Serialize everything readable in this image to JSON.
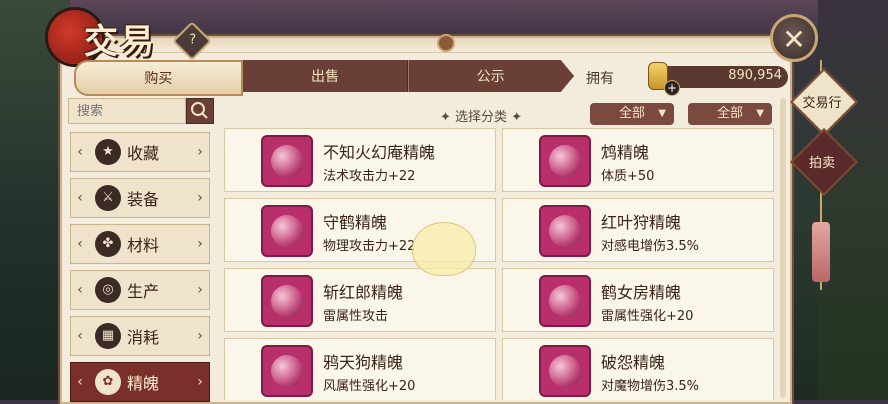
{
  "window": {
    "title": "交易",
    "help_label": "?",
    "close_label": "✕"
  },
  "tabs": [
    {
      "label": "购买",
      "active": true
    },
    {
      "label": "出售",
      "active": false
    },
    {
      "label": "公示",
      "active": false
    }
  ],
  "currency": {
    "label": "拥有",
    "value": "890,954",
    "plus": "+"
  },
  "side_menu": [
    {
      "label": "交易行"
    },
    {
      "label": "拍卖"
    }
  ],
  "search": {
    "placeholder": "搜索"
  },
  "category": {
    "label": "选择分类",
    "filter1": "全部",
    "filter2": "全部"
  },
  "sidebar": {
    "items": [
      {
        "label": "收藏",
        "icon": "★",
        "icon_name": "star-icon"
      },
      {
        "label": "装备",
        "icon": "⚔",
        "icon_name": "sword-icon"
      },
      {
        "label": "材料",
        "icon": "✤",
        "icon_name": "herb-icon"
      },
      {
        "label": "生产",
        "icon": "◎",
        "icon_name": "pot-icon"
      },
      {
        "label": "消耗",
        "icon": "▦",
        "icon_name": "scroll-icon"
      },
      {
        "label": "精魄",
        "icon": "✿",
        "icon_name": "spirit-icon"
      }
    ]
  },
  "items": [
    {
      "name": "不知火幻庵精魄",
      "desc": "法术攻击力+22"
    },
    {
      "name": "鸩精魄",
      "desc": "体质+50"
    },
    {
      "name": "守鹤精魄",
      "desc": "物理攻击力+22"
    },
    {
      "name": "红叶狩精魄",
      "desc": "对感电增伤3.5%"
    },
    {
      "name": "斩红郎精魄",
      "desc": "雷属性攻击"
    },
    {
      "name": "鹤女房精魄",
      "desc": "雷属性强化+20"
    },
    {
      "name": "鸦天狗精魄",
      "desc": "风属性强化+20"
    },
    {
      "name": "破怨精魄",
      "desc": "对魔物增伤3.5%"
    }
  ],
  "colors": {
    "accent": "#7a2f2a",
    "tab_dark": "#6a3f36",
    "panel": "#f3ebdc",
    "item_icon": "#b82f6b"
  }
}
